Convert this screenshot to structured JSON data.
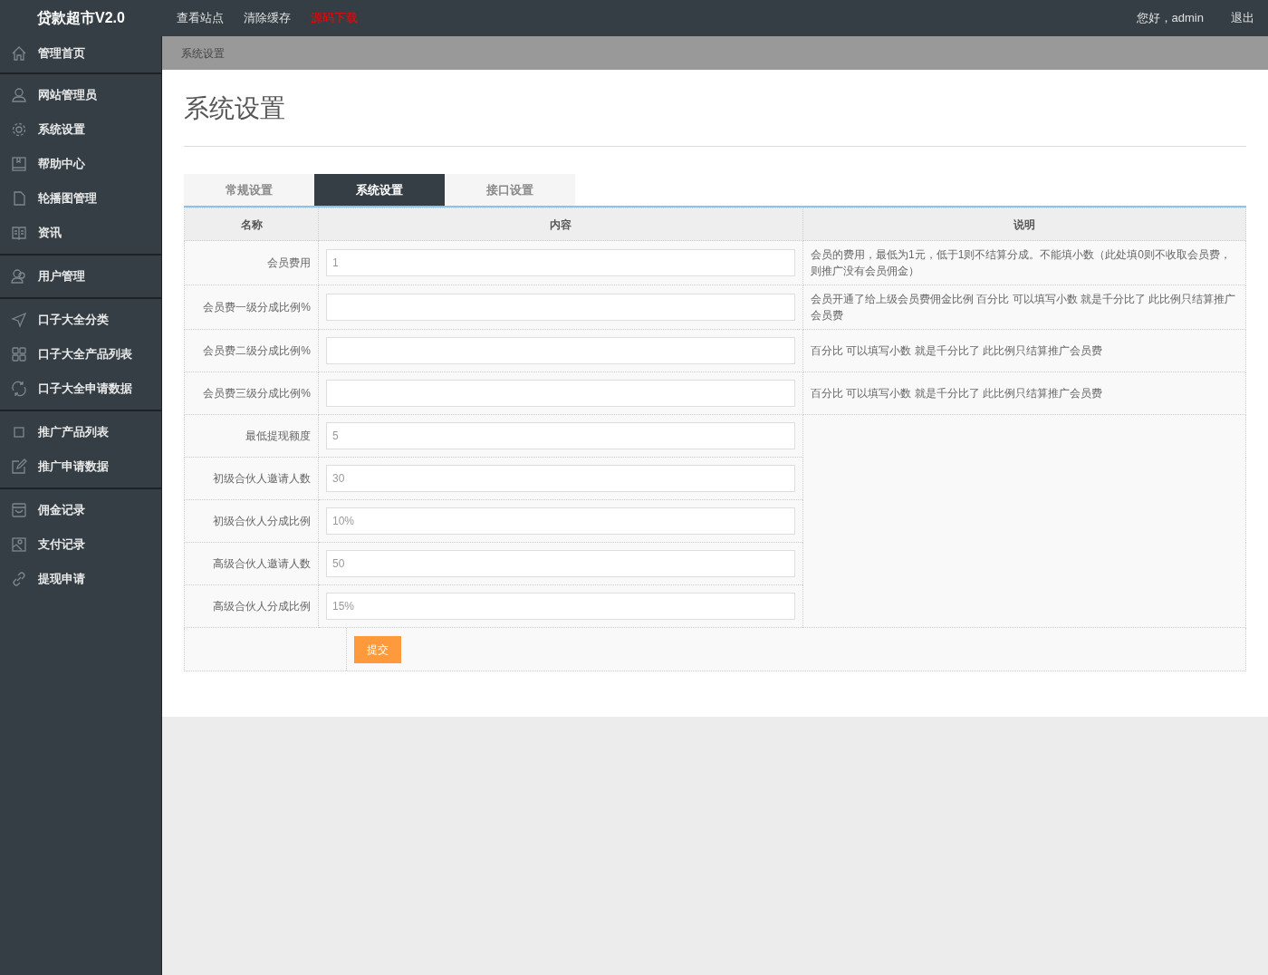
{
  "brand": "贷款超市V2.0",
  "top_links": [
    {
      "label": "查看站点",
      "highlight": false
    },
    {
      "label": "清除缓存",
      "highlight": false
    },
    {
      "label": "源码下载",
      "highlight": true
    }
  ],
  "greeting": "您好，admin",
  "logout": "退出",
  "sidebar": {
    "groups": [
      {
        "items": [
          {
            "label": "管理首页"
          }
        ]
      },
      {
        "items": [
          {
            "label": "网站管理员"
          },
          {
            "label": "系统设置"
          },
          {
            "label": "帮助中心"
          },
          {
            "label": "轮播图管理"
          },
          {
            "label": "资讯"
          }
        ]
      },
      {
        "items": [
          {
            "label": "用户管理"
          }
        ]
      },
      {
        "items": [
          {
            "label": "口子大全分类"
          },
          {
            "label": "口子大全产品列表"
          },
          {
            "label": "口子大全申请数据"
          }
        ]
      },
      {
        "items": [
          {
            "label": "推广产品列表"
          },
          {
            "label": "推广申请数据"
          }
        ]
      },
      {
        "items": [
          {
            "label": "佣金记录"
          },
          {
            "label": "支付记录"
          },
          {
            "label": "提现申请"
          }
        ]
      }
    ]
  },
  "breadcrumb": "系统设置",
  "page_title": "系统设置",
  "tabs": [
    {
      "label": "常规设置",
      "selected": false
    },
    {
      "label": "系统设置",
      "selected": true
    },
    {
      "label": "接口设置",
      "selected": false
    }
  ],
  "table": {
    "columns": [
      "名称",
      "内容",
      "说明"
    ],
    "rows": [
      {
        "label": "会员费用",
        "value": "1",
        "note": "会员的费用，最低为1元，低于1则不结算分成。不能填小数（此处填0则不收取会员费，则推广没有会员佣金）"
      },
      {
        "label": "会员费一级分成比例%",
        "value": "",
        "note": "会员开通了给上级会员费佣金比例 百分比 可以填写小数 就是千分比了 此比例只结算推广会员费"
      },
      {
        "label": "会员费二级分成比例%",
        "value": "",
        "note": "百分比 可以填写小数 就是千分比了 此比例只结算推广会员费"
      },
      {
        "label": "会员费三级分成比例%",
        "value": "",
        "note": "百分比 可以填写小数 就是千分比了 此比例只结算推广会员费"
      },
      {
        "label": "最低提现额度",
        "value": "5"
      },
      {
        "label": "初级合伙人邀请人数",
        "value": "30"
      },
      {
        "label": "初级合伙人分成比例",
        "value": "10%"
      },
      {
        "label": "高级合伙人邀请人数",
        "value": "50"
      },
      {
        "label": "高级合伙人分成比例",
        "value": "15%"
      }
    ]
  },
  "submit": "提交"
}
